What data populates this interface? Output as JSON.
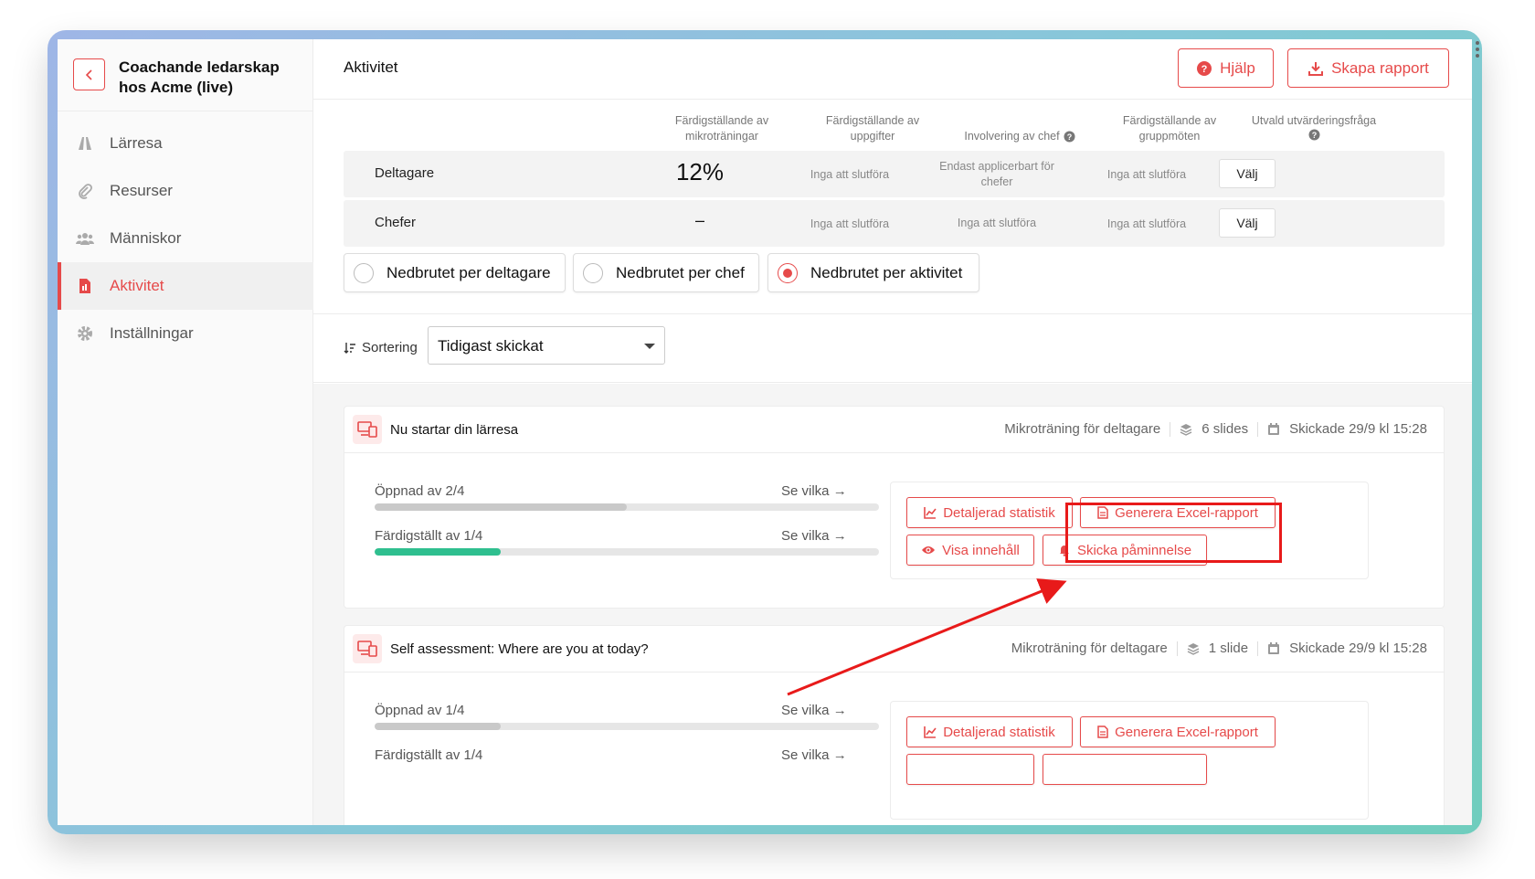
{
  "sidebar": {
    "title_line1": "Coachande ledarskap",
    "title_line2": "hos Acme (live)",
    "items": [
      {
        "label": "Lärresa",
        "icon": "road-icon"
      },
      {
        "label": "Resurser",
        "icon": "paperclip-icon"
      },
      {
        "label": "Människor",
        "icon": "people-icon"
      },
      {
        "label": "Aktivitet",
        "icon": "document-icon",
        "active": true
      },
      {
        "label": "Inställningar",
        "icon": "gear-icon"
      }
    ]
  },
  "header": {
    "title": "Aktivitet",
    "help_label": "Hjälp",
    "report_label": "Skapa rapport"
  },
  "stats": {
    "columns": [
      "Färdigställande av mikroträningar",
      "Färdigställande av uppgifter",
      "Involvering av chef",
      "Färdigställande av gruppmöten",
      "Utvald utvärderingsfråga"
    ],
    "rows": [
      {
        "label": "Deltagare",
        "micro": "12%",
        "tasks": "Inga att slutföra",
        "manager": "Endast applicerbart för chefer",
        "groups": "Inga att slutföra",
        "select": "Välj"
      },
      {
        "label": "Chefer",
        "micro": "–",
        "tasks": "Inga att slutföra",
        "manager": "Inga att slutföra",
        "groups": "Inga att slutföra",
        "select": "Välj"
      }
    ]
  },
  "breakdown": {
    "options": [
      "Nedbrutet per deltagare",
      "Nedbrutet per chef",
      "Nedbrutet per aktivitet"
    ],
    "selected": "Nedbrutet per aktivitet"
  },
  "sort": {
    "label": "Sortering",
    "value": "Tidigast skickat"
  },
  "cards": [
    {
      "title": "Nu startar din lärresa",
      "type": "Mikroträning för deltagare",
      "slides": "6 slides",
      "sent": "Skickade 29/9 kl 15:28",
      "opened_label": "Öppnad av 2/4",
      "opened_fraction": 0.5,
      "completed_label": "Färdigställt av 1/4",
      "completed_fraction": 0.25,
      "see_which": "Se vilka",
      "btn_stats": "Detaljerad statistik",
      "btn_excel": "Generera Excel-rapport",
      "btn_view": "Visa innehåll",
      "btn_remind": "Skicka påminnelse"
    },
    {
      "title": "Self assessment: Where are you at today?",
      "type": "Mikroträning för deltagare",
      "slides": "1 slide",
      "sent": "Skickade 29/9 kl 15:28",
      "opened_label": "Öppnad av 1/4",
      "opened_fraction": 0.25,
      "completed_label": "Färdigställt av 1/4",
      "completed_fraction": 0.25,
      "see_which": "Se vilka",
      "btn_stats": "Detaljerad statistik",
      "btn_excel": "Generera Excel-rapport"
    }
  ],
  "colors": {
    "accent": "#e64a4a",
    "progress_green": "#2fbf8f",
    "progress_grey": "#c9c9c9",
    "annotation": "#e81a1a"
  }
}
